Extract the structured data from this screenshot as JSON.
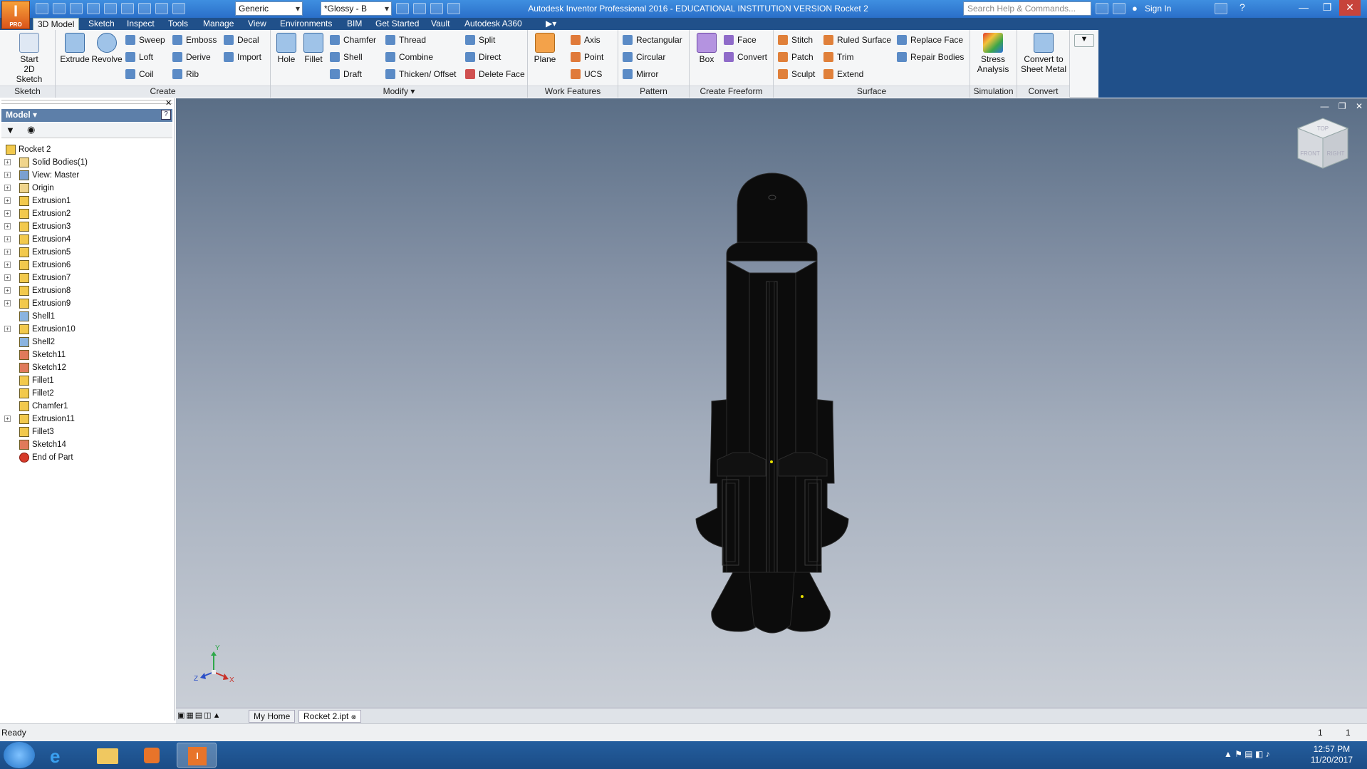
{
  "app": {
    "logo_text": "I",
    "logo_sub": "PRO",
    "title": "Autodesk Inventor Professional 2016 - EDUCATIONAL INSTITUTION VERSION    Rocket 2",
    "appearance_combo": "Generic",
    "material_combo": "*Glossy - B",
    "search_placeholder": "Search Help & Commands...",
    "signin_label": "Sign In"
  },
  "tabs": [
    "3D Model",
    "Sketch",
    "Inspect",
    "Tools",
    "Manage",
    "View",
    "Environments",
    "BIM",
    "Get Started",
    "Vault",
    "Autodesk A360"
  ],
  "ribbon": {
    "sketch": {
      "title": "Sketch",
      "start_2d_sketch": "Start\n2D Sketch"
    },
    "create": {
      "title": "Create",
      "extrude": "Extrude",
      "revolve": "Revolve",
      "sweep": "Sweep",
      "loft": "Loft",
      "coil": "Coil",
      "emboss": "Emboss",
      "derive": "Derive",
      "rib": "Rib",
      "decal": "Decal",
      "import": "Import"
    },
    "modify": {
      "title": "Modify ▾",
      "hole": "Hole",
      "fillet": "Fillet",
      "chamfer": "Chamfer",
      "shell": "Shell",
      "draft": "Draft",
      "thread": "Thread",
      "combine": "Combine",
      "thicken": "Thicken/ Offset",
      "split": "Split",
      "direct": "Direct",
      "delete_face": "Delete Face"
    },
    "work_features": {
      "title": "Work Features",
      "plane": "Plane",
      "axis": "Axis",
      "point": "Point",
      "ucs": "UCS"
    },
    "pattern": {
      "title": "Pattern",
      "rectangular": "Rectangular",
      "circular": "Circular",
      "mirror": "Mirror"
    },
    "freeform": {
      "title": "Create Freeform",
      "box": "Box",
      "face": "Face",
      "convert": "Convert"
    },
    "surface": {
      "title": "Surface",
      "stitch": "Stitch",
      "patch": "Patch",
      "sculpt": "Sculpt",
      "ruled_surface": "Ruled Surface",
      "trim": "Trim",
      "extend": "Extend",
      "replace_face": "Replace Face",
      "repair_bodies": "Repair Bodies"
    },
    "simulation": {
      "title": "Simulation",
      "stress_analysis": "Stress\nAnalysis"
    },
    "convert": {
      "title": "Convert",
      "to_sheet_metal": "Convert to\nSheet Metal"
    }
  },
  "browser": {
    "title": "Model ▾",
    "tree": [
      {
        "label": "Rocket 2",
        "icon": "part",
        "expand": false,
        "indent": 0
      },
      {
        "label": "Solid Bodies(1)",
        "icon": "folder",
        "expand": true,
        "indent": 1
      },
      {
        "label": "View: Master",
        "icon": "view",
        "expand": true,
        "indent": 1
      },
      {
        "label": "Origin",
        "icon": "folder",
        "expand": true,
        "indent": 1
      },
      {
        "label": "Extrusion1",
        "icon": "feature",
        "expand": true,
        "indent": 1
      },
      {
        "label": "Extrusion2",
        "icon": "feature",
        "expand": true,
        "indent": 1
      },
      {
        "label": "Extrusion3",
        "icon": "feature",
        "expand": true,
        "indent": 1
      },
      {
        "label": "Extrusion4",
        "icon": "feature",
        "expand": true,
        "indent": 1
      },
      {
        "label": "Extrusion5",
        "icon": "feature",
        "expand": true,
        "indent": 1
      },
      {
        "label": "Extrusion6",
        "icon": "feature",
        "expand": true,
        "indent": 1
      },
      {
        "label": "Extrusion7",
        "icon": "feature",
        "expand": true,
        "indent": 1
      },
      {
        "label": "Extrusion8",
        "icon": "feature",
        "expand": true,
        "indent": 1
      },
      {
        "label": "Extrusion9",
        "icon": "feature",
        "expand": true,
        "indent": 1
      },
      {
        "label": "Shell1",
        "icon": "shell",
        "expand": false,
        "indent": 1
      },
      {
        "label": "Extrusion10",
        "icon": "feature",
        "expand": true,
        "indent": 1
      },
      {
        "label": "Shell2",
        "icon": "shell",
        "expand": false,
        "indent": 1
      },
      {
        "label": "Sketch11",
        "icon": "sketch",
        "expand": false,
        "indent": 1
      },
      {
        "label": "Sketch12",
        "icon": "sketch",
        "expand": false,
        "indent": 1
      },
      {
        "label": "Fillet1",
        "icon": "fillet",
        "expand": false,
        "indent": 1
      },
      {
        "label": "Fillet2",
        "icon": "fillet",
        "expand": false,
        "indent": 1
      },
      {
        "label": "Chamfer1",
        "icon": "chamfer",
        "expand": false,
        "indent": 1
      },
      {
        "label": "Extrusion11",
        "icon": "feature",
        "expand": true,
        "indent": 1
      },
      {
        "label": "Fillet3",
        "icon": "fillet",
        "expand": false,
        "indent": 1
      },
      {
        "label": "Sketch14",
        "icon": "sketch",
        "expand": false,
        "indent": 1
      },
      {
        "label": "End of Part",
        "icon": "end",
        "expand": false,
        "indent": 1
      }
    ]
  },
  "viewcube": {
    "top": "TOP",
    "front": "FRONT",
    "right": "RIGHT"
  },
  "triad": {
    "x": "X",
    "y": "Y",
    "z": "Z"
  },
  "doc_tabs": [
    "My Home",
    "Rocket 2.ipt"
  ],
  "status": {
    "text": "Ready",
    "count1": "1",
    "count2": "1"
  },
  "clock": {
    "time": "12:57 PM",
    "date": "11/20/2017"
  },
  "colors": {
    "titlebar": "#2a6fc9",
    "viewport_top": "#5a6e86",
    "viewport_bottom": "#c9ced6",
    "model": "#0c0c0c"
  }
}
